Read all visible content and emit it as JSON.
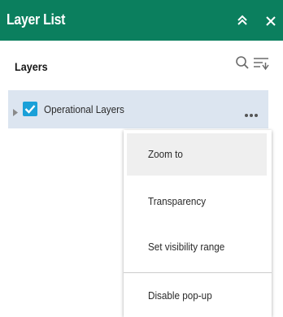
{
  "header": {
    "title": "Layer List",
    "collapse_icon": "double-chevron-up-icon",
    "close_icon": "close-icon",
    "background": "#0b7f5e"
  },
  "section": {
    "title": "Layers",
    "search_icon": "search-icon",
    "filter_icon": "filter-icon"
  },
  "layer": {
    "label": "Operational Layers",
    "checked": true,
    "expand_icon": "caret-right-icon",
    "more_icon": "more-horizontal-icon",
    "row_background": "#dce5f0",
    "checkbox_color": "#1aa0d8"
  },
  "menu": {
    "items": [
      {
        "label": "Zoom to",
        "active": true
      },
      {
        "label": "Transparency",
        "active": false
      },
      {
        "label": "Set visibility range",
        "active": false
      },
      {
        "label": "Disable pop-up",
        "active": false
      }
    ]
  }
}
